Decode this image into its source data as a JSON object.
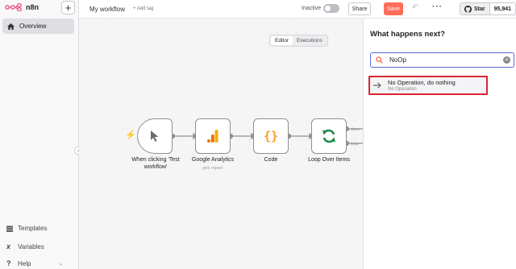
{
  "app": {
    "name": "n8n"
  },
  "sidebar": {
    "overview": "Overview",
    "templates": "Templates",
    "variables": "Variables",
    "help": "Help"
  },
  "header": {
    "workflow_name": "My workflow",
    "add_tag": "+ Add tag",
    "status": "Inactive",
    "share": "Share",
    "save": "Save",
    "github_star": "Star",
    "github_count": "95,941"
  },
  "canvas": {
    "tabs": [
      "Editor",
      "Executions"
    ],
    "nodes": [
      {
        "label_line1": "When clicking 'Test",
        "label_line2": "workflow'",
        "icon": "cursor-icon"
      },
      {
        "label": "Google Analytics",
        "sub": "get: report",
        "icon": "google-analytics-icon"
      },
      {
        "label": "Code",
        "icon": "code-braces-icon"
      },
      {
        "label": "Loop Over Items",
        "icon": "loop-icon"
      }
    ],
    "loop_outputs": [
      "done",
      "loop"
    ]
  },
  "panel": {
    "title": "What happens next?",
    "search_value": "NoOp",
    "result": {
      "title": "No Operation, do nothing",
      "subtitle": "No Operation"
    }
  },
  "colors": {
    "accent": "#ff6d5a",
    "highlight": "#d9262f",
    "search_border": "#5b6bd8"
  }
}
